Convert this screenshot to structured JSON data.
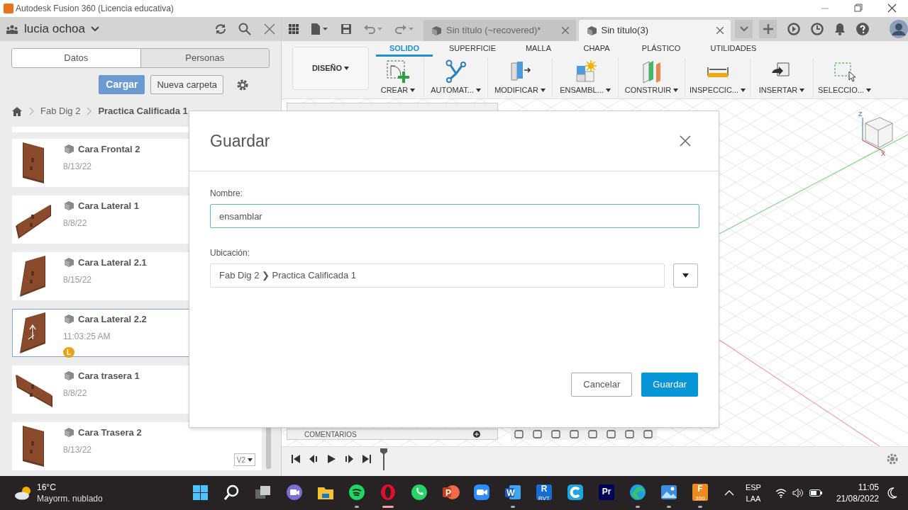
{
  "window": {
    "title": "Autodesk Fusion 360 (Licencia educativa)"
  },
  "data_panel": {
    "user": "lucia ochoa",
    "tabs": [
      {
        "label": "Datos",
        "selected": true
      },
      {
        "label": "Personas",
        "selected": false
      }
    ],
    "upload_button": "Cargar",
    "new_folder_button": "Nueva carpeta",
    "breadcrumb": [
      "Fab Dig 2",
      "Practica Calificada 1"
    ],
    "files": [
      {
        "name": "Cara Frontal 2",
        "date": "8/13/22",
        "selected": false
      },
      {
        "name": "Cara Lateral 1",
        "date": "8/8/22",
        "selected": false
      },
      {
        "name": "Cara Lateral 2.1",
        "date": "8/15/22",
        "selected": false
      },
      {
        "name": "Cara Lateral 2.2",
        "date": "11:03:25 AM",
        "selected": true,
        "badge": "L"
      },
      {
        "name": "Cara trasera 1",
        "date": "8/8/22",
        "selected": false
      },
      {
        "name": "Cara Trasera 2",
        "date": "8/13/22",
        "selected": false,
        "version": "V2"
      }
    ]
  },
  "document_tabs": [
    {
      "label": "Sin título (~recovered)*",
      "selected": false
    },
    {
      "label": "Sin título(3)",
      "selected": true
    }
  ],
  "toolbar": {
    "workspace": "DISEÑO",
    "ribbon_tabs": [
      {
        "label": "SOLIDO",
        "selected": true
      },
      {
        "label": "SUPERFICIE",
        "selected": false
      },
      {
        "label": "MALLA",
        "selected": false
      },
      {
        "label": "CHAPA",
        "selected": false
      },
      {
        "label": "PLÁSTICO",
        "selected": false
      },
      {
        "label": "UTILIDADES",
        "selected": false
      }
    ],
    "tools": [
      {
        "label": "CREAR",
        "kind": "create"
      },
      {
        "label": "AUTOMAT...",
        "kind": "automate"
      },
      {
        "label": "MODIFICAR",
        "kind": "modify"
      },
      {
        "label": "ENSAMBL...",
        "kind": "assemble"
      },
      {
        "label": "CONSTRUIR",
        "kind": "construct"
      },
      {
        "label": "INSPECCIC...",
        "kind": "inspect"
      },
      {
        "label": "INSERTAR",
        "kind": "insert"
      },
      {
        "label": "SELECCIO...",
        "kind": "select"
      }
    ]
  },
  "viewport": {
    "axis_labels": [
      "Z",
      "X"
    ],
    "comments_panel": "COMENTARIOS"
  },
  "dialog": {
    "title": "Guardar",
    "name_label": "Nombre:",
    "name_value": "ensamblar",
    "location_label": "Ubicación:",
    "location": "Fab Dig 2 ❯ Practica Calificada 1",
    "buttons": [
      {
        "label": "Cancelar",
        "kind": "secondary"
      },
      {
        "label": "Guardar",
        "kind": "primary"
      }
    ]
  },
  "taskbar": {
    "temperature": "16°C",
    "weather": "Mayorm. nublado",
    "apps": [
      {
        "kind": "start",
        "running": false
      },
      {
        "kind": "search",
        "running": false
      },
      {
        "kind": "taskview",
        "running": false
      },
      {
        "kind": "chat",
        "running": false
      },
      {
        "kind": "explorer",
        "running": false
      },
      {
        "kind": "spotify",
        "running": true
      },
      {
        "kind": "opera",
        "running": true,
        "active": true
      },
      {
        "kind": "whatsapp",
        "running": false
      },
      {
        "kind": "powerpoint",
        "label": "P",
        "running": false
      },
      {
        "kind": "zoom",
        "running": false
      },
      {
        "kind": "word",
        "label": "W",
        "running": true
      },
      {
        "kind": "revit",
        "label": "R",
        "sub": "RVT",
        "running": false
      },
      {
        "kind": "ccleaner",
        "running": false
      },
      {
        "kind": "premiere",
        "label": "Pr",
        "running": false
      },
      {
        "kind": "edge",
        "running": true
      },
      {
        "kind": "photos",
        "running": true
      },
      {
        "kind": "fusion",
        "label": "F",
        "sub": "360",
        "running": true
      }
    ],
    "language": [
      "ESP",
      "LAA"
    ],
    "time": "11:05",
    "date": "21/08/2022"
  }
}
